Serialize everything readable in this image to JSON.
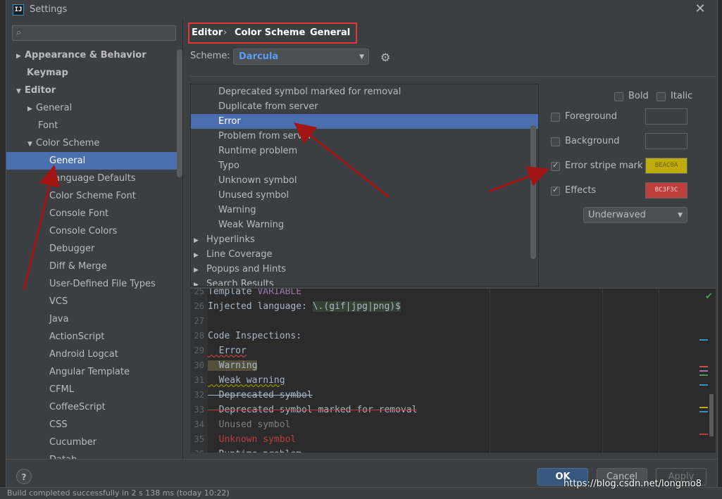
{
  "window": {
    "title": "Settings",
    "app_icon_text": "IJ"
  },
  "search": {
    "placeholder": ""
  },
  "breadcrumb": {
    "items": [
      "Editor",
      "Color Scheme",
      "General"
    ],
    "separator": "›"
  },
  "scheme": {
    "label": "Scheme:",
    "value": "Darcula"
  },
  "sidebar": {
    "items": [
      {
        "label": "Appearance & Behavior",
        "expand": "▶"
      },
      {
        "label": "Keymap"
      },
      {
        "label": "Editor",
        "expand": "▼"
      },
      {
        "label": "General",
        "expand": "▶"
      },
      {
        "label": "Font"
      },
      {
        "label": "Color Scheme",
        "expand": "▼"
      },
      {
        "label": "General",
        "selected": true
      },
      {
        "label": "Language Defaults"
      },
      {
        "label": "Color Scheme Font"
      },
      {
        "label": "Console Font"
      },
      {
        "label": "Console Colors"
      },
      {
        "label": "Debugger"
      },
      {
        "label": "Diff & Merge"
      },
      {
        "label": "User-Defined File Types"
      },
      {
        "label": "VCS"
      },
      {
        "label": "Java"
      },
      {
        "label": "ActionScript"
      },
      {
        "label": "Android Logcat"
      },
      {
        "label": "Angular Template"
      },
      {
        "label": "CFML"
      },
      {
        "label": "CoffeeScript"
      },
      {
        "label": "CSS"
      },
      {
        "label": "Cucumber"
      },
      {
        "label": "Datab"
      }
    ]
  },
  "attributes": {
    "items": [
      {
        "label": "Deprecated symbol marked for removal"
      },
      {
        "label": "Duplicate from server"
      },
      {
        "label": "Error",
        "selected": true
      },
      {
        "label": "Problem from server"
      },
      {
        "label": "Runtime problem"
      },
      {
        "label": "Typo"
      },
      {
        "label": "Unknown symbol"
      },
      {
        "label": "Unused symbol"
      },
      {
        "label": "Warning"
      },
      {
        "label": "Weak Warning"
      },
      {
        "label": "Hyperlinks",
        "expand": "▶"
      },
      {
        "label": "Line Coverage",
        "expand": "▶"
      },
      {
        "label": "Popups and Hints",
        "expand": "▶"
      },
      {
        "label": "Search Results",
        "expand": "▶"
      }
    ]
  },
  "options": {
    "bold": {
      "label": "Bold",
      "checked": false
    },
    "italic": {
      "label": "Italic",
      "checked": false
    },
    "foreground": {
      "label": "Foreground",
      "checked": false,
      "color": ""
    },
    "background": {
      "label": "Background",
      "checked": false,
      "color": ""
    },
    "error_stripe": {
      "label": "Error stripe mark",
      "checked": true,
      "color": "BEAC0A",
      "color_hex": "#beac0a"
    },
    "effects": {
      "label": "Effects",
      "checked": true,
      "color": "BC3F3C",
      "color_hex": "#bc3f3c"
    },
    "effect_type": "Underwaved"
  },
  "preview": {
    "lines": [
      {
        "num": "25",
        "parts": [
          {
            "t": "Template ",
            "c": "#a9b7c6"
          },
          {
            "t": "VARIABLE",
            "c": "#9876aa"
          }
        ]
      },
      {
        "num": "26",
        "parts": [
          {
            "t": "Injected language: ",
            "c": "#a9b7c6"
          },
          {
            "t": "\\.(gif|jpg|png)$",
            "c": "#a9b7c6",
            "bg": "#364135"
          }
        ]
      },
      {
        "num": "27",
        "parts": []
      },
      {
        "num": "28",
        "parts": [
          {
            "t": "Code Inspections:",
            "c": "#a9b7c6"
          }
        ]
      },
      {
        "num": "29",
        "parts": [
          {
            "t": "  Error",
            "c": "#a9b7c6",
            "deco": "wavy-red"
          }
        ]
      },
      {
        "num": "30",
        "parts": [
          {
            "t": "  Warning",
            "c": "#a9b7c6",
            "bg": "#52503a"
          }
        ]
      },
      {
        "num": "31",
        "parts": [
          {
            "t": "  Weak warning",
            "c": "#a9b7c6",
            "deco": "wavy-olive"
          }
        ]
      },
      {
        "num": "32",
        "parts": [
          {
            "t": "  Deprecated symbol",
            "c": "#a9b7c6",
            "deco": "strike"
          }
        ]
      },
      {
        "num": "33",
        "parts": [
          {
            "t": "  Deprecated symbol marked for removal",
            "c": "#a9b7c6",
            "deco": "strike-red"
          }
        ]
      },
      {
        "num": "34",
        "parts": [
          {
            "t": "  Unused symbol",
            "c": "#808080"
          }
        ]
      },
      {
        "num": "35",
        "parts": [
          {
            "t": "  Unknown symbol",
            "c": "#bc3f3c"
          }
        ]
      },
      {
        "num": "36",
        "parts": [
          {
            "t": "  Runtime problem",
            "c": "#a9b7c6"
          }
        ]
      }
    ]
  },
  "buttons": {
    "help": "?",
    "ok": "OK",
    "cancel": "Cancel",
    "apply": "Apply"
  },
  "status_bar": {
    "text": "Build completed successfully in 2 s 138 ms (today 10:22)"
  },
  "watermark": "https://blog.csdn.net/longmo8",
  "colors": {
    "selection": "#4b6eaf",
    "accent_blue": "#589df6",
    "annotation": "#b71c1c",
    "highlight_border": "#e53935"
  }
}
